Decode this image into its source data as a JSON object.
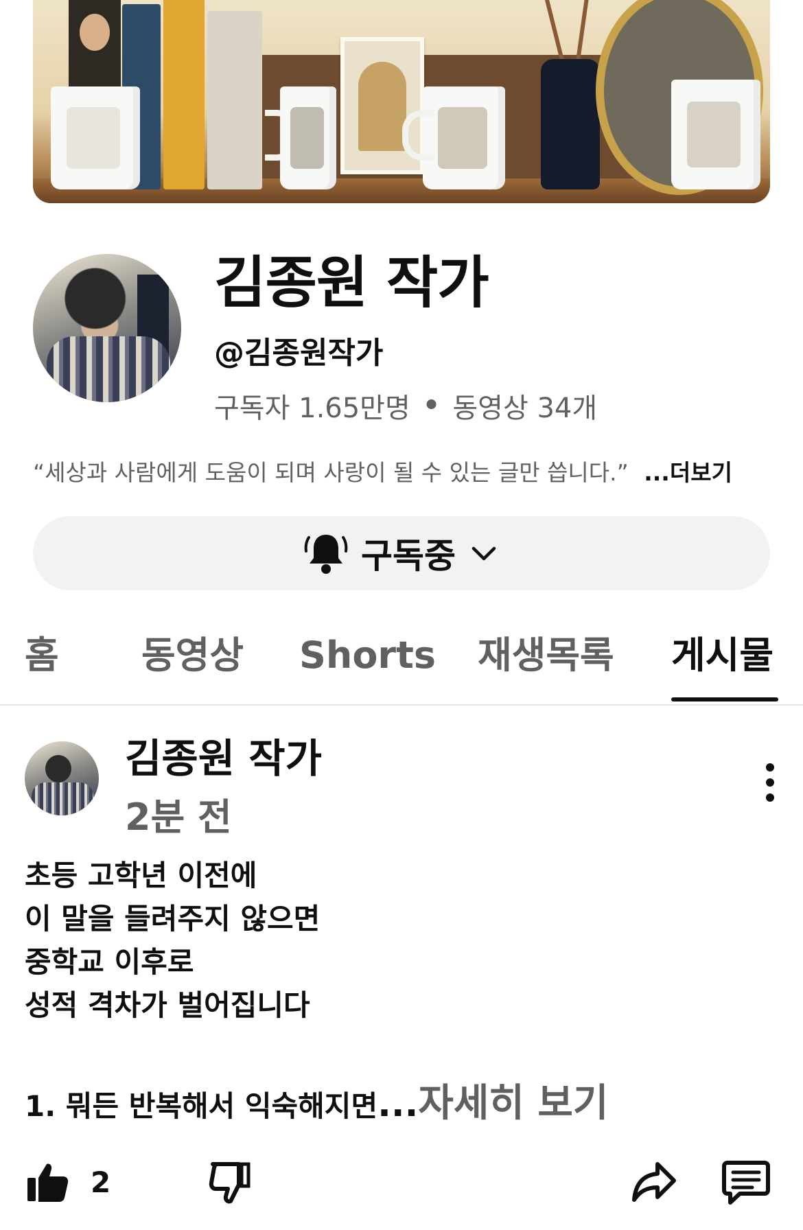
{
  "channel": {
    "name": "김종원 작가",
    "handle": "@김종원작가",
    "subscribers": "구독자 1.65만명",
    "separator": "•",
    "videos": "동영상 34개",
    "description": "“세상과 사람에게 도움이 되며 사랑이 될 수 있는 글만 씁니다.”",
    "more_label": "...더보기"
  },
  "subscribe": {
    "label": "구독중",
    "icon": "bell-ringing-icon",
    "dropdown_icon": "chevron-down-icon"
  },
  "tabs": [
    {
      "label": "홈",
      "active": false
    },
    {
      "label": "동영상",
      "active": false
    },
    {
      "label": "Shorts",
      "active": false
    },
    {
      "label": "재생목록",
      "active": false
    },
    {
      "label": "게시물",
      "active": true
    }
  ],
  "post": {
    "author": "김종원 작가",
    "time": "2분 전",
    "body_lines": [
      "초등 고학년 이전에",
      "이 말을 들려주지 않으면",
      "중학교 이후로",
      "성적 격차가 벌어집니다"
    ],
    "first_item": "1. 뭐든 반복해서 익숙해지면",
    "ellipsis": "...",
    "read_more": "자세히 보기",
    "likes": "2"
  },
  "colors": {
    "text_primary": "#0f0f0f",
    "text_secondary": "#606060",
    "button_bg": "#f2f2f2",
    "divider": "#e5e5e5"
  }
}
